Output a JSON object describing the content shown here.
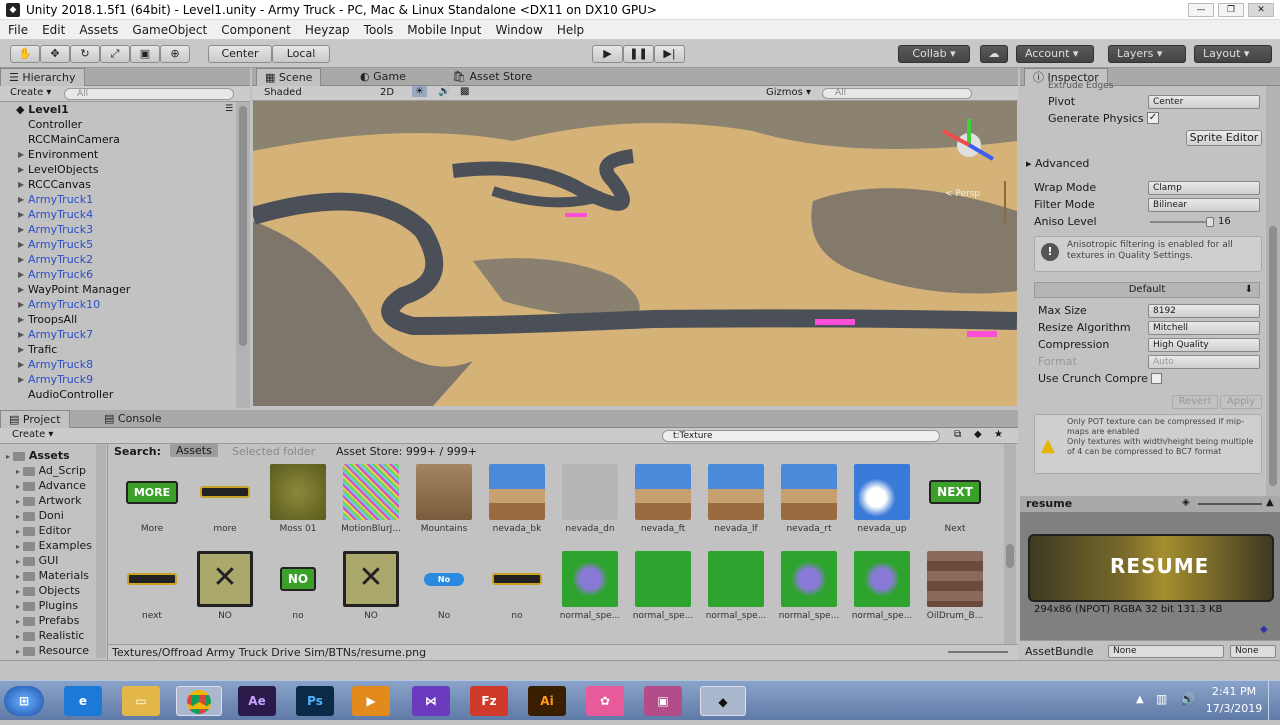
{
  "window": {
    "title": "Unity 2018.1.5f1 (64bit) - Level1.unity - Army Truck - PC, Mac & Linux Standalone <DX11 on DX10 GPU>"
  },
  "menu": [
    "File",
    "Edit",
    "Assets",
    "GameObject",
    "Component",
    "Heyzap",
    "Tools",
    "Mobile Input",
    "Window",
    "Help"
  ],
  "toolbar": {
    "center": "Center",
    "local": "Local",
    "collab": "Collab ▾",
    "account": "Account",
    "layers": "Layers",
    "layout": "Layout"
  },
  "hierarchy": {
    "tab": "Hierarchy",
    "create": "Create ▾",
    "search_placeholder": "All",
    "scene": "Level1",
    "items": [
      {
        "label": "Controller",
        "blue": false,
        "arrow": false
      },
      {
        "label": "RCCMainCamera",
        "blue": false,
        "arrow": false
      },
      {
        "label": "Environment",
        "blue": false,
        "arrow": true
      },
      {
        "label": "LevelObjects",
        "blue": false,
        "arrow": true
      },
      {
        "label": "RCCCanvas",
        "blue": false,
        "arrow": true
      },
      {
        "label": "ArmyTruck1",
        "blue": true,
        "arrow": true
      },
      {
        "label": "ArmyTruck4",
        "blue": true,
        "arrow": true
      },
      {
        "label": "ArmyTruck3",
        "blue": true,
        "arrow": true
      },
      {
        "label": "ArmyTruck5",
        "blue": true,
        "arrow": true
      },
      {
        "label": "ArmyTruck2",
        "blue": true,
        "arrow": true
      },
      {
        "label": "ArmyTruck6",
        "blue": true,
        "arrow": true
      },
      {
        "label": "WayPoint Manager",
        "blue": false,
        "arrow": true
      },
      {
        "label": "ArmyTruck10",
        "blue": true,
        "arrow": true
      },
      {
        "label": "TroopsAll",
        "blue": false,
        "arrow": true
      },
      {
        "label": "ArmyTruck7",
        "blue": true,
        "arrow": true
      },
      {
        "label": "Trafic",
        "blue": false,
        "arrow": true
      },
      {
        "label": "ArmyTruck8",
        "blue": true,
        "arrow": true
      },
      {
        "label": "ArmyTruck9",
        "blue": true,
        "arrow": true
      },
      {
        "label": "AudioController",
        "blue": false,
        "arrow": false
      }
    ]
  },
  "scene": {
    "tabs": [
      "Scene",
      "Game",
      "Asset Store"
    ],
    "shaded": "Shaded",
    "mode2d": "2D",
    "gizmos": "Gizmos ▾",
    "search_placeholder": "All",
    "persp": "< Persp"
  },
  "inspector": {
    "tab": "Inspector",
    "extrude": "Extrude Edges",
    "pivot_label": "Pivot",
    "pivot_value": "Center",
    "gen_physics": "Generate Physics",
    "sprite_editor": "Sprite Editor",
    "advanced": "Advanced",
    "wrap_label": "Wrap Mode",
    "wrap_value": "Clamp",
    "filter_label": "Filter Mode",
    "filter_value": "Bilinear",
    "aniso_label": "Aniso Level",
    "aniso_value": "16",
    "aniso_note": "Anisotropic filtering is enabled for all textures in Quality Settings.",
    "default_tab": "Default",
    "maxsize_label": "Max Size",
    "maxsize_value": "8192",
    "resize_label": "Resize Algorithm",
    "resize_value": "Mitchell",
    "compression_label": "Compression",
    "compression_value": "High Quality",
    "format_label": "Format",
    "format_value": "Auto",
    "crunch_label": "Use Crunch Compre",
    "revert": "Revert",
    "apply": "Apply",
    "warning": "Only POT texture can be compressed if mip-maps are enabled\nOnly textures with width/height being multiple of 4 can be compressed to BC7 format",
    "preview_name": "resume",
    "preview_text": "RESUME",
    "preview_info": "294x86 (NPOT)  RGBA 32 bit   131.3 KB",
    "assetbundle_label": "AssetBundle",
    "assetbundle_value": "None",
    "assetbundle_variant": "None"
  },
  "project": {
    "tabs": [
      "Project",
      "Console"
    ],
    "create": "Create ▾",
    "search_value": "t:Texture",
    "search_label": "Search:",
    "filter_assets": "Assets",
    "filter_selected": "Selected folder",
    "asset_store": "Asset Store: 999+ / 999+",
    "tree": [
      "Assets",
      "Ad_Scrip",
      "Advance",
      "Artwork",
      "Doni",
      "Editor",
      "Examples",
      "GUI",
      "Materials",
      "Objects",
      "Plugins",
      "Prefabs",
      "Realistic",
      "Resource"
    ],
    "row1": [
      {
        "name": "More",
        "kind": "btn-more"
      },
      {
        "name": "more",
        "kind": "btn-dark"
      },
      {
        "name": "Moss 01",
        "kind": "moss"
      },
      {
        "name": "MotionBlurJ...",
        "kind": "noise"
      },
      {
        "name": "Mountains",
        "kind": "mountains"
      },
      {
        "name": "nevada_bk",
        "kind": "sky"
      },
      {
        "name": "nevada_dn",
        "kind": "empty"
      },
      {
        "name": "nevada_ft",
        "kind": "sky"
      },
      {
        "name": "nevada_lf",
        "kind": "sky"
      },
      {
        "name": "nevada_rt",
        "kind": "sky"
      },
      {
        "name": "nevada_up",
        "kind": "cloud"
      },
      {
        "name": "Next",
        "kind": "btn-next"
      }
    ],
    "row2": [
      {
        "name": "next",
        "kind": "btn-dark"
      },
      {
        "name": "NO",
        "kind": "no-x"
      },
      {
        "name": "no",
        "kind": "btn-no"
      },
      {
        "name": "NO",
        "kind": "no-x"
      },
      {
        "name": "No",
        "kind": "btn-blue"
      },
      {
        "name": "no",
        "kind": "btn-dark"
      },
      {
        "name": "normal_spe...",
        "kind": "green-flower"
      },
      {
        "name": "normal_spe...",
        "kind": "green"
      },
      {
        "name": "normal_spe...",
        "kind": "green"
      },
      {
        "name": "normal_spe...",
        "kind": "green-flower"
      },
      {
        "name": "normal_spe...",
        "kind": "green-flower"
      },
      {
        "name": "OilDrum_B...",
        "kind": "drum"
      }
    ],
    "labels": {
      "more": "MORE",
      "next": "NEXT",
      "no": "NO",
      "no_small": "No"
    },
    "path": "Textures/Offroad Army Truck Drive Sim/BTNs/resume.png"
  },
  "taskbar": {
    "time": "2:41 PM",
    "date": "17/3/2019"
  }
}
